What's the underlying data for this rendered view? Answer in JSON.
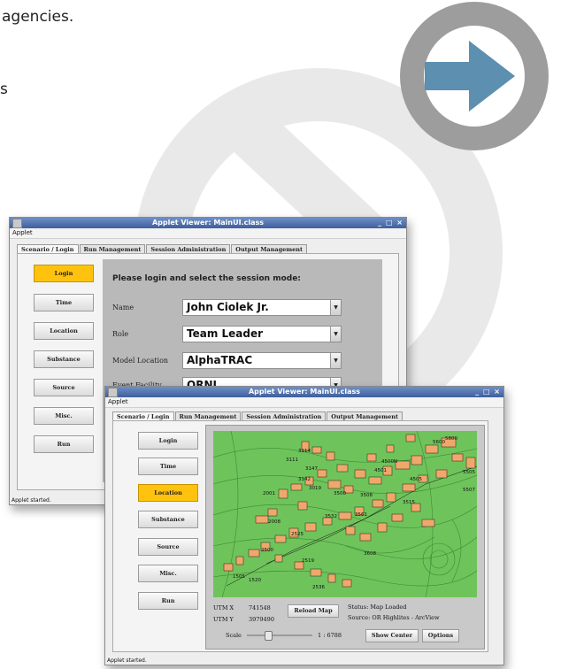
{
  "headline": {
    "line1": "agencies.",
    "line2": "s"
  },
  "win_back": {
    "title": "Applet Viewer: MainUI.class",
    "menu": "Applet",
    "tabs": [
      "Scenario / Login",
      "Run Management",
      "Session Administration",
      "Output Management"
    ],
    "nav": [
      "Login",
      "Time",
      "Location",
      "Substance",
      "Source",
      "Misc.",
      "Run"
    ],
    "selected_nav": "Login",
    "form_title": "Please login and select the session mode:",
    "fields": [
      {
        "label": "Name",
        "value": "John Ciolek Jr."
      },
      {
        "label": "Role",
        "value": "Team Leader"
      },
      {
        "label": "Model Location",
        "value": "AlphaTRAC"
      },
      {
        "label": "Event Facility",
        "value": "ORNL"
      }
    ],
    "status": "Applet started."
  },
  "win_front": {
    "title": "Applet Viewer: MainUI.class",
    "menu": "Applet",
    "tabs": [
      "Scenario / Login",
      "Run Management",
      "Session Administration",
      "Output Management"
    ],
    "nav": [
      "Login",
      "Time",
      "Location",
      "Substance",
      "Source",
      "Misc.",
      "Run"
    ],
    "selected_nav": "Location",
    "map_labels": [
      "3114",
      "3111",
      "3147",
      "3142",
      "3019",
      "2001",
      "3500",
      "4501",
      "4500N",
      "5600",
      "5800",
      "5505",
      "5507",
      "4505",
      "3508",
      "3515",
      "2008",
      "2525",
      "3532",
      "3561",
      "2500",
      "2519",
      "3608",
      "1505",
      "1520",
      "2536"
    ],
    "utm_x_label": "UTM X",
    "utm_x_value": "741548",
    "utm_y_label": "UTM Y",
    "utm_y_value": "3979490",
    "reload_label": "Reload Map",
    "status_text": "Status: Map Loaded",
    "source_text": "Source: OR Highlites - ArcView",
    "scale_label": "Scale",
    "scale_value": "1 : 6788",
    "scale_level": 0.3,
    "show_center_label": "Show Center",
    "options_label": "Options",
    "status": "Applet started."
  },
  "colors": {
    "selected": "#ffc20e",
    "map_green": "#6fc35b",
    "building": "#f0a86a",
    "arrow_blue": "#5d8fb0",
    "ring_gray": "#9d9d9d"
  }
}
